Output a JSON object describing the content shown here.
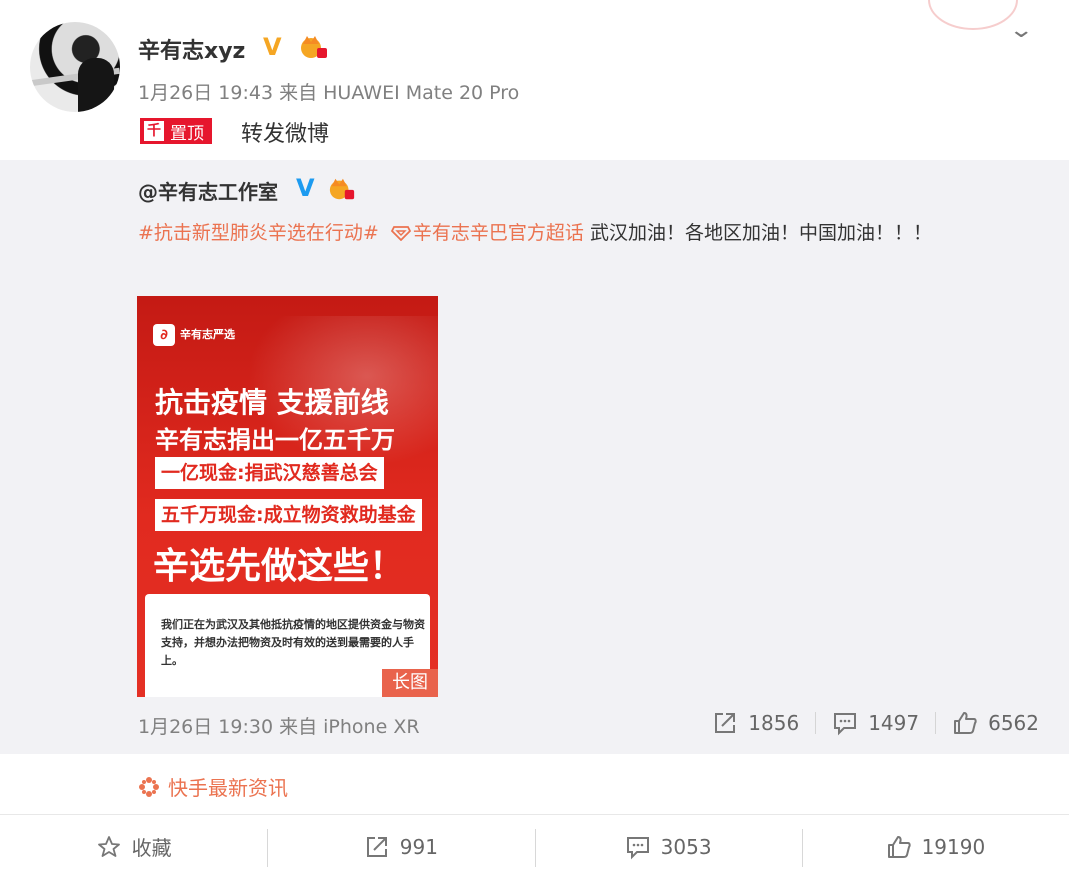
{
  "post": {
    "username": "辛有志xyz",
    "verified_badge": "V",
    "meta": "1月26日 19:43 来自 HUAWEI Mate 20 Pro",
    "pinned_label": "置顶",
    "pinned_icon": "pin-icon",
    "text": "转发微博"
  },
  "repost": {
    "author": "@辛有志工作室",
    "verified_badge": "V",
    "topic": "#抗击新型肺炎辛选在行动#",
    "supertopic": "辛有志辛巴官方超话",
    "body": " 武汉加油！各地区加油！中国加油！！！",
    "time": "1月26日 19:30 来自 iPhone XR",
    "repost_count": "1856",
    "comment_count": "1497",
    "like_count": "6562"
  },
  "poster": {
    "brand": "辛有志严选",
    "headline1": "抗击疫情  支援前线",
    "headline2": "辛有志捐出一亿五千万",
    "box1": "一亿现金:捐武汉慈善总会",
    "box2": "五千万现金:成立物资救助基金",
    "headline3": "辛选先做这些！",
    "card_text": "我们正在为武汉及其他抵抗疫情的地区提供资金与物资支持，并想办法把物资及时有效的送到最需要的人手上。",
    "long_label": "长图"
  },
  "source": {
    "label": "快手最新资讯"
  },
  "footer": {
    "favorite_label": "收藏",
    "repost_count": "991",
    "comment_count": "3053",
    "like_count": "19190"
  },
  "colors": {
    "accent_orange": "#eb7350",
    "weibo_red": "#e6162d",
    "verified_gold": "#f5a623",
    "verified_blue": "#1d9bf0"
  }
}
